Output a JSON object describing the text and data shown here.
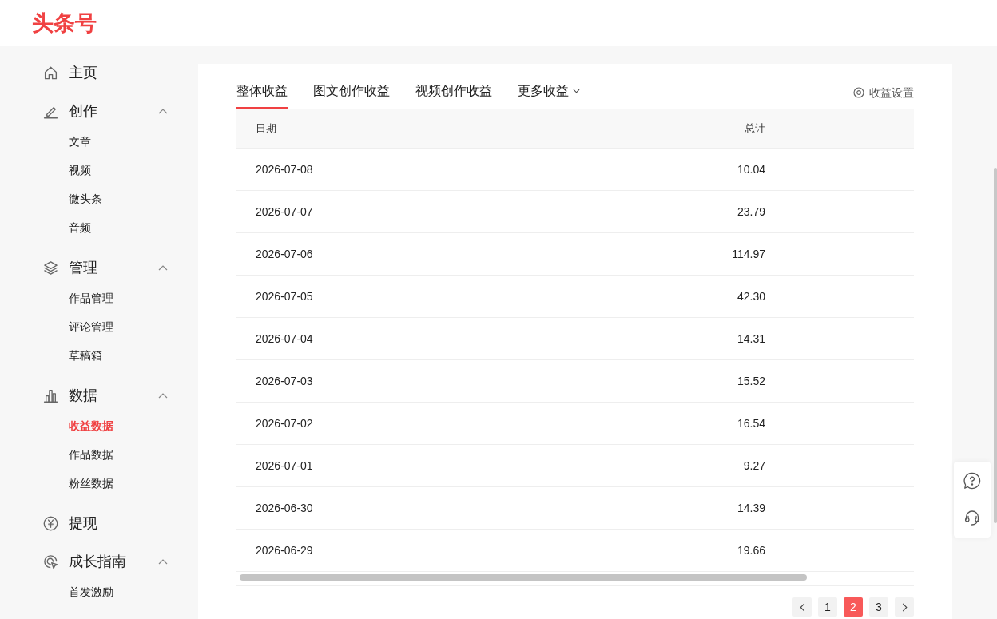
{
  "logo": "头条号",
  "sidebar": {
    "items": [
      {
        "kind": "link",
        "label": "主页"
      },
      {
        "kind": "group",
        "label": "创作",
        "expanded": true,
        "children": [
          {
            "label": "文章",
            "selected": false
          },
          {
            "label": "视频",
            "selected": false
          },
          {
            "label": "微头条",
            "selected": false
          },
          {
            "label": "音频",
            "selected": false
          }
        ]
      },
      {
        "kind": "group",
        "label": "管理",
        "expanded": true,
        "children": [
          {
            "label": "作品管理",
            "selected": false
          },
          {
            "label": "评论管理",
            "selected": false
          },
          {
            "label": "草稿箱",
            "selected": false
          }
        ]
      },
      {
        "kind": "group",
        "label": "数据",
        "expanded": true,
        "children": [
          {
            "label": "收益数据",
            "selected": true
          },
          {
            "label": "作品数据",
            "selected": false
          },
          {
            "label": "粉丝数据",
            "selected": false
          }
        ]
      },
      {
        "kind": "link",
        "label": "提现"
      },
      {
        "kind": "group",
        "label": "成长指南",
        "expanded": true,
        "children": [
          {
            "label": "首发激励",
            "selected": false
          }
        ]
      }
    ]
  },
  "tabs": [
    {
      "kind": "tab",
      "label": "整体收益",
      "selected": true
    },
    {
      "kind": "tab",
      "label": "图文创作收益",
      "selected": false
    },
    {
      "kind": "tab",
      "label": "视频创作收益",
      "selected": false
    },
    {
      "kind": "dropdown",
      "label": "更多收益",
      "selected": false
    }
  ],
  "settings_link": "收益设置",
  "table": {
    "columns": [
      "日期",
      "总计"
    ],
    "rows": [
      [
        "2026-07-08",
        "10.04"
      ],
      [
        "2026-07-07",
        "23.79"
      ],
      [
        "2026-07-06",
        "114.97"
      ],
      [
        "2026-07-05",
        "42.30"
      ],
      [
        "2026-07-04",
        "14.31"
      ],
      [
        "2026-07-03",
        "15.52"
      ],
      [
        "2026-07-02",
        "16.54"
      ],
      [
        "2026-07-01",
        "9.27"
      ],
      [
        "2026-06-30",
        "14.39"
      ],
      [
        "2026-06-29",
        "19.66"
      ]
    ]
  },
  "pagination": {
    "pages": [
      {
        "label": "1",
        "selected": false
      },
      {
        "label": "2",
        "selected": true
      },
      {
        "label": "3",
        "selected": false
      }
    ]
  }
}
